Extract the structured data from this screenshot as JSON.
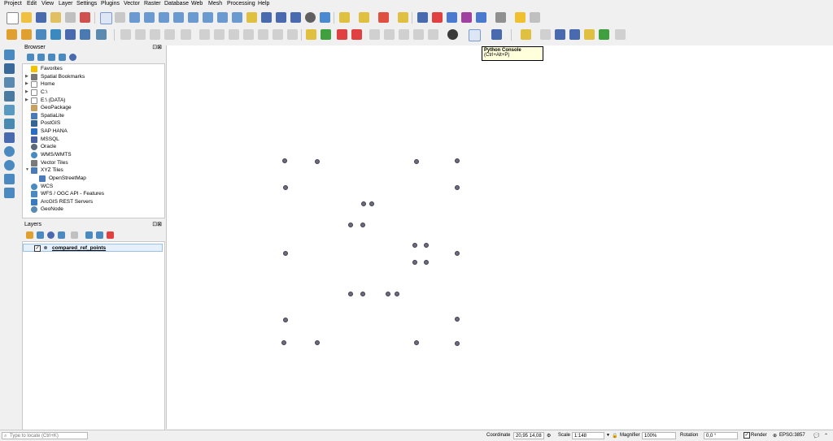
{
  "menu": [
    "Project",
    "Edit",
    "View",
    "Layer",
    "Settings",
    "Plugins",
    "Vector",
    "Raster",
    "Database",
    "Web",
    "Mesh",
    "Processing",
    "Help"
  ],
  "browser": {
    "title": "Browser",
    "items": [
      {
        "label": "Favorites",
        "icon": "star-icon",
        "color": "#f2c200"
      },
      {
        "label": "Spatial Bookmarks",
        "icon": "bookmark-icon",
        "color": "#777777"
      },
      {
        "label": "Home",
        "icon": "folder-icon",
        "color": "#d9d9d9"
      },
      {
        "label": "C:\\",
        "icon": "drive-icon",
        "color": "#d9d9d9"
      },
      {
        "label": "E:\\ (DATA)",
        "icon": "drive-icon",
        "color": "#d9d9d9"
      },
      {
        "label": "GeoPackage",
        "icon": "geopackage-icon",
        "color": "#c8a060"
      },
      {
        "label": "SpatiaLite",
        "icon": "spatialite-icon",
        "color": "#4a7ab8"
      },
      {
        "label": "PostGIS",
        "icon": "postgis-icon",
        "color": "#336791"
      },
      {
        "label": "SAP HANA",
        "icon": "saphana-icon",
        "color": "#2a6fbf"
      },
      {
        "label": "MSSQL",
        "icon": "mssql-icon",
        "color": "#4a5fa0"
      },
      {
        "label": "Oracle",
        "icon": "oracle-icon",
        "color": "#5a6a7a"
      },
      {
        "label": "WMS/WMTS",
        "icon": "wms-icon",
        "color": "#4a8ac0"
      },
      {
        "label": "Vector Tiles",
        "icon": "vector-tiles-icon",
        "color": "#7a7a7a"
      },
      {
        "label": "XYZ Tiles",
        "icon": "xyz-tiles-icon",
        "color": "#4a7ab8"
      },
      {
        "label": "OpenStreetMap",
        "icon": "osm-icon",
        "color": "#4a7ab8"
      },
      {
        "label": "WCS",
        "icon": "wcs-icon",
        "color": "#4a8ac0"
      },
      {
        "label": "WFS / OGC API - Features",
        "icon": "wfs-icon",
        "color": "#4a8ac0"
      },
      {
        "label": "ArcGIS REST Servers",
        "icon": "arcgis-icon",
        "color": "#3a7ac0"
      },
      {
        "label": "GeoNode",
        "icon": "geonode-icon",
        "color": "#5a8ab0"
      }
    ]
  },
  "layers": {
    "title": "Layers",
    "items": [
      {
        "label": "compared_ref_points",
        "checked": true
      }
    ]
  },
  "tooltip": {
    "title": "Python Console",
    "shortcut": "(Ctrl+Alt+P)"
  },
  "status": {
    "locate_placeholder": "Type to locate (Ctrl+K)",
    "coordinate_label": "Coordinate",
    "coordinate_value": "20,95 14,08",
    "scale_label": "Scale",
    "scale_value": "1:148",
    "magnifier_label": "Magnifier",
    "magnifier_value": "100%",
    "rotation_label": "Rotation",
    "rotation_value": "0,0 °",
    "render_label": "Render",
    "crs_label": "EPSG:3857"
  },
  "points_color": "#6c6c7e"
}
